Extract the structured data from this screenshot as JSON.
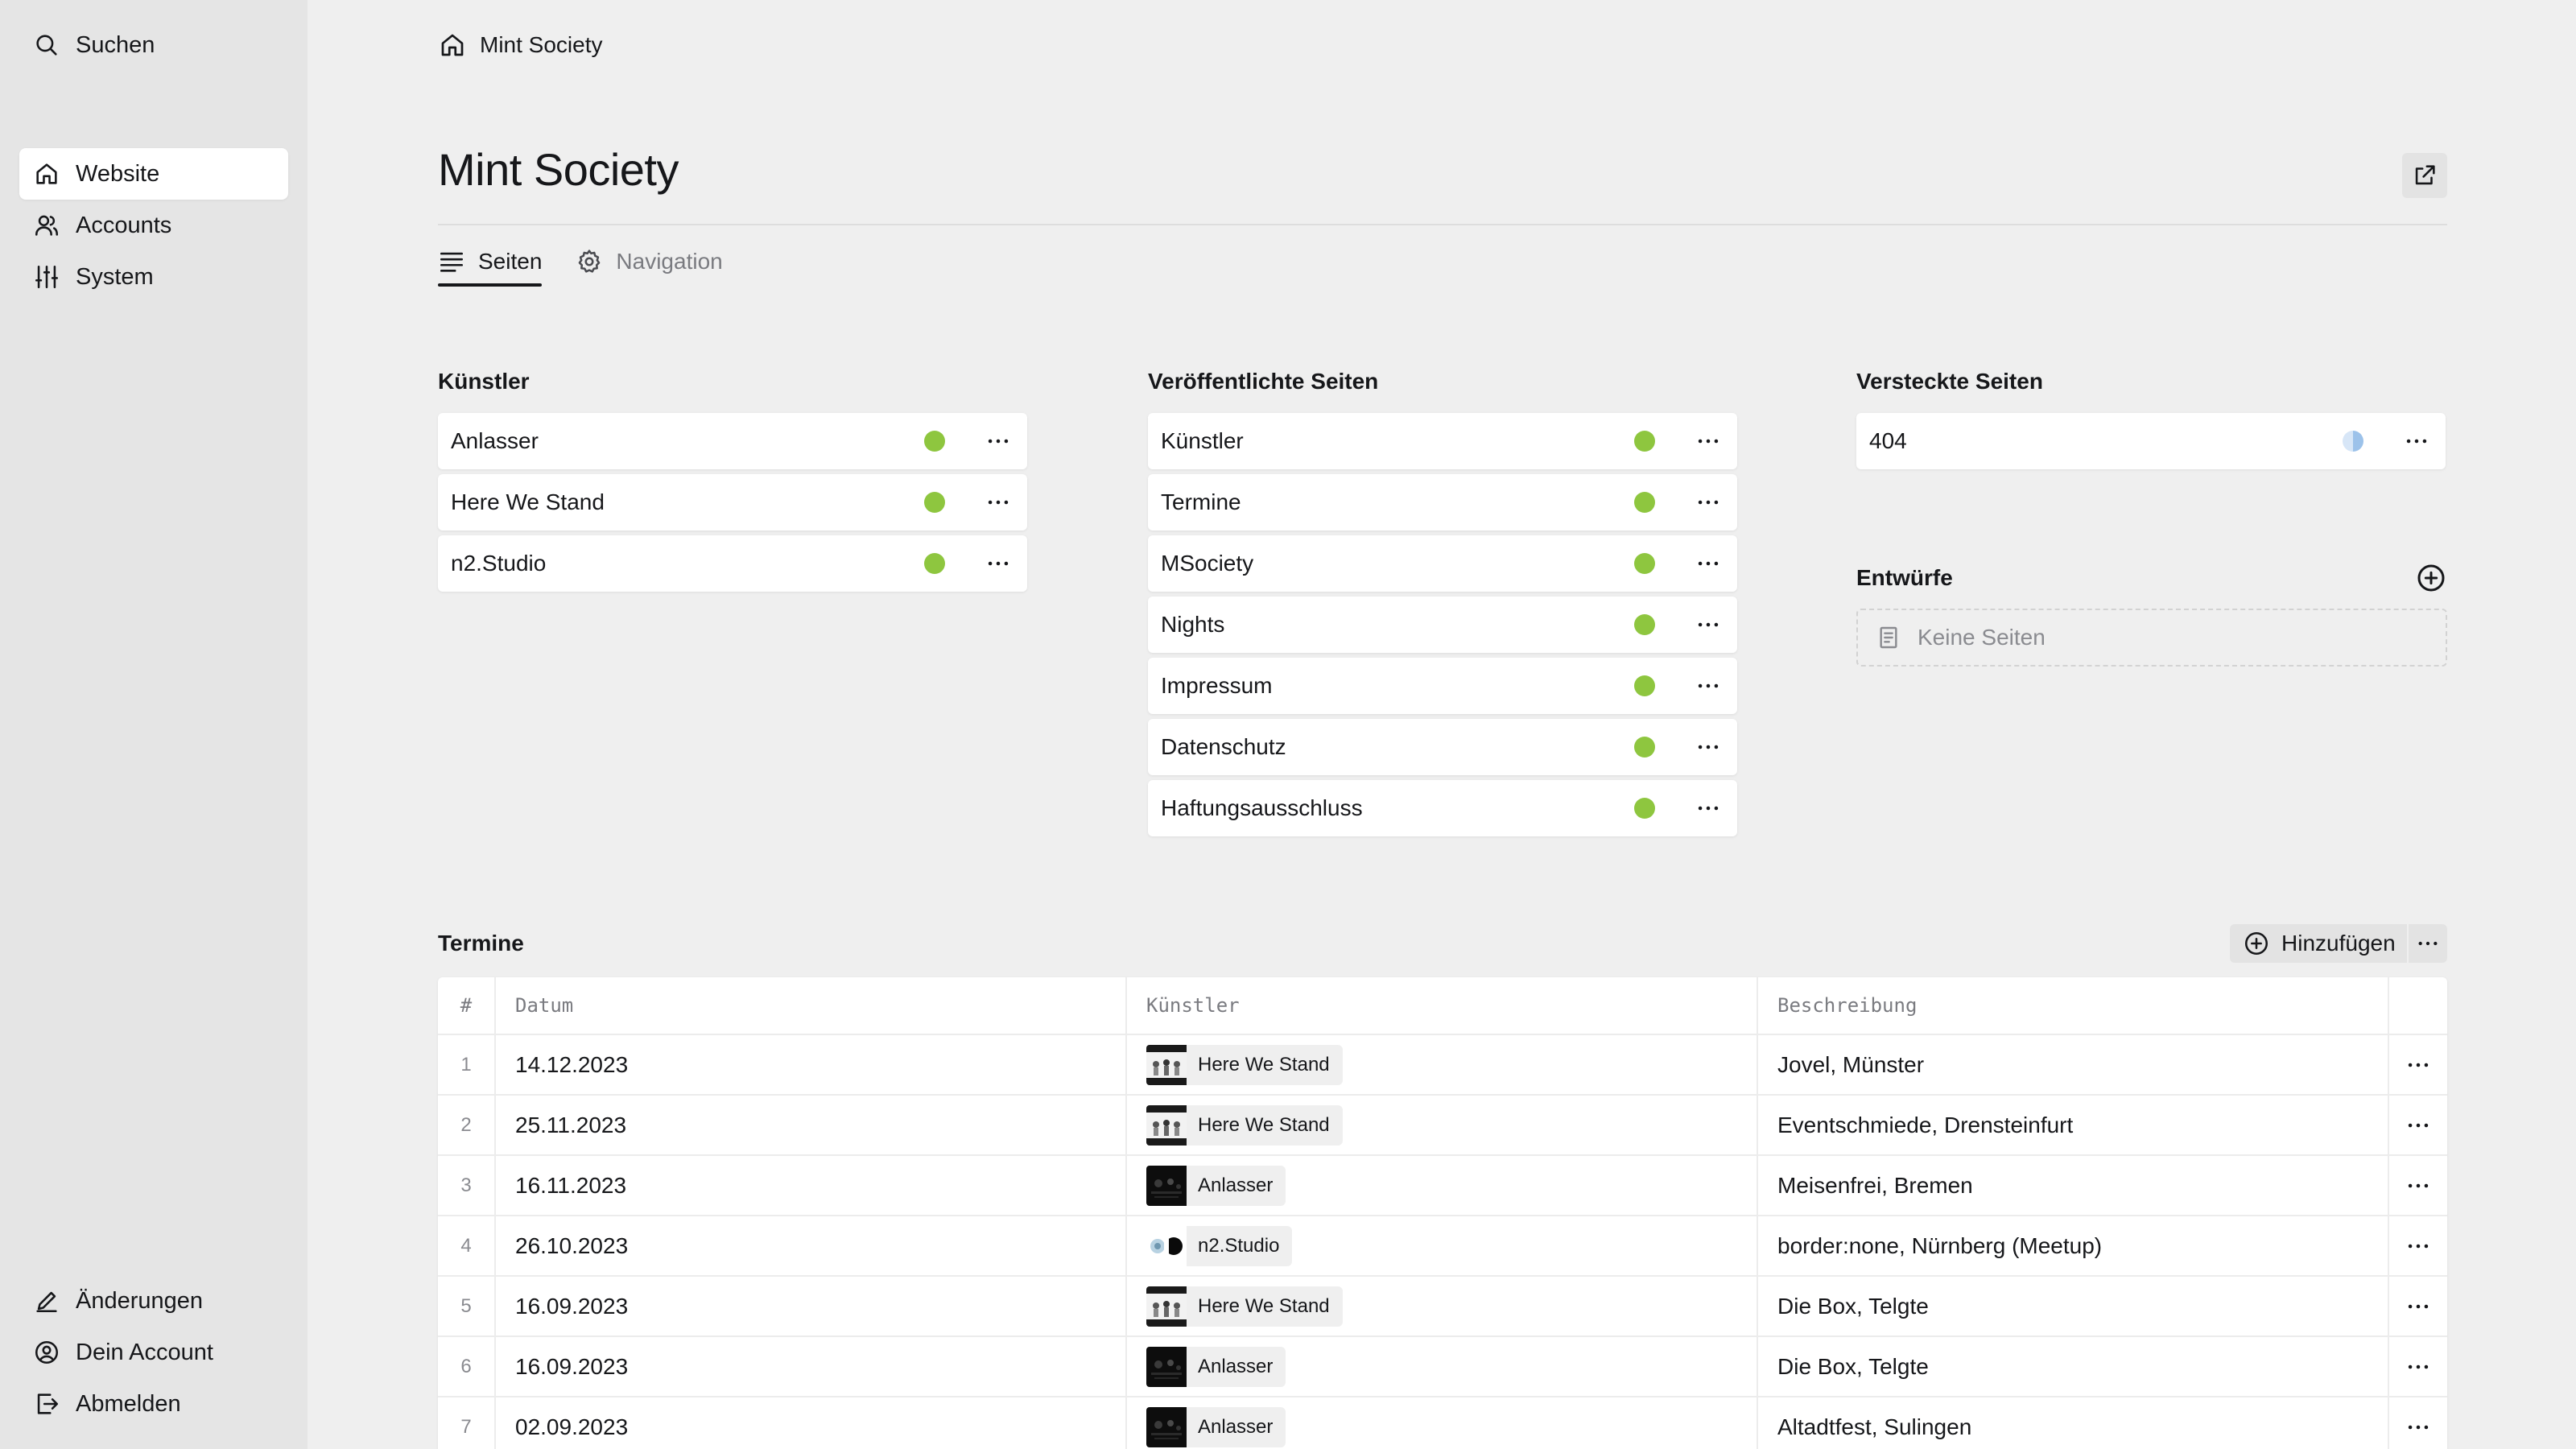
{
  "sidebar": {
    "search_label": "Suchen",
    "nav": [
      {
        "label": "Website",
        "icon": "home-icon",
        "active": true
      },
      {
        "label": "Accounts",
        "icon": "users-icon",
        "active": false
      },
      {
        "label": "System",
        "icon": "sliders-icon",
        "active": false
      }
    ],
    "bottom": [
      {
        "label": "Änderungen",
        "icon": "edit-icon"
      },
      {
        "label": "Dein Account",
        "icon": "account-icon"
      },
      {
        "label": "Abmelden",
        "icon": "logout-icon"
      }
    ]
  },
  "breadcrumb": {
    "label": "Mint Society",
    "icon": "home-icon"
  },
  "page": {
    "title": "Mint Society",
    "open_icon": "external-link-icon"
  },
  "tabs": [
    {
      "label": "Seiten",
      "icon": "list-icon",
      "active": true
    },
    {
      "label": "Navigation",
      "icon": "gear-icon",
      "active": false
    }
  ],
  "columns": {
    "kuenstler": {
      "title": "Künstler",
      "items": [
        {
          "label": "Anlasser",
          "status": "published"
        },
        {
          "label": "Here We Stand",
          "status": "published"
        },
        {
          "label": "n2.Studio",
          "status": "published"
        }
      ]
    },
    "published": {
      "title": "Veröffentlichte Seiten",
      "items": [
        {
          "label": "Künstler",
          "status": "published"
        },
        {
          "label": "Termine",
          "status": "published"
        },
        {
          "label": "MSociety",
          "status": "published"
        },
        {
          "label": "Nights",
          "status": "published"
        },
        {
          "label": "Impressum",
          "status": "published"
        },
        {
          "label": "Datenschutz",
          "status": "published"
        },
        {
          "label": "Haftungsausschluss",
          "status": "published"
        }
      ]
    },
    "hidden": {
      "title": "Versteckte Seiten",
      "items": [
        {
          "label": "404",
          "status": "unlisted"
        }
      ]
    },
    "drafts": {
      "title": "Entwürfe",
      "empty_label": "Keine Seiten"
    }
  },
  "colors": {
    "published": "#8ec63f",
    "unlisted": "#9cc2ea",
    "sidebar_bg": "#e5e5e5",
    "page_bg": "#efefef"
  },
  "termine": {
    "title": "Termine",
    "add_label": "Hinzufügen",
    "headers": {
      "num": "#",
      "date": "Datum",
      "artist": "Künstler",
      "desc": "Beschreibung"
    },
    "rows": [
      {
        "num": "1",
        "date": "14.12.2023",
        "artist": "Here We Stand",
        "thumb": "hws",
        "desc": "Jovel, Münster"
      },
      {
        "num": "2",
        "date": "25.11.2023",
        "artist": "Here We Stand",
        "thumb": "hws",
        "desc": "Eventschmiede, Drensteinfurt"
      },
      {
        "num": "3",
        "date": "16.11.2023",
        "artist": "Anlasser",
        "thumb": "anl",
        "desc": "Meisenfrei, Bremen"
      },
      {
        "num": "4",
        "date": "26.10.2023",
        "artist": "n2.Studio",
        "thumb": "n2",
        "desc": "border:none, Nürnberg (Meetup)"
      },
      {
        "num": "5",
        "date": "16.09.2023",
        "artist": "Here We Stand",
        "thumb": "hws",
        "desc": "Die Box, Telgte"
      },
      {
        "num": "6",
        "date": "16.09.2023",
        "artist": "Anlasser",
        "thumb": "anl",
        "desc": "Die Box, Telgte"
      },
      {
        "num": "7",
        "date": "02.09.2023",
        "artist": "Anlasser",
        "thumb": "anl",
        "desc": "Altadtfest, Sulingen"
      }
    ]
  }
}
